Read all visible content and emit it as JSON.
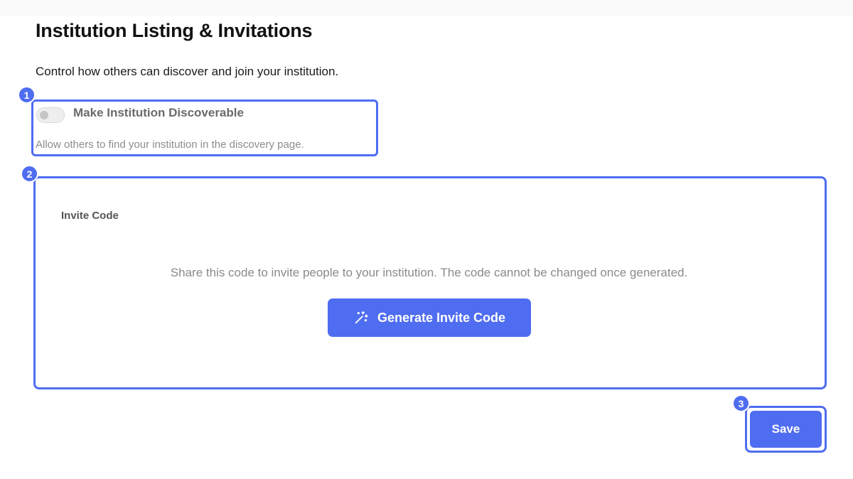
{
  "page": {
    "title": "Institution Listing & Invitations",
    "subtitle": "Control how others can discover and join your institution."
  },
  "discoverable": {
    "label": "Make Institution Discoverable",
    "help": "Allow others to find your institution in the discovery page.",
    "enabled": false
  },
  "invite": {
    "title": "Invite Code",
    "description": "Share this code to invite people to your institution. The code cannot be changed once generated.",
    "button_label": "Generate Invite Code",
    "button_icon": "magic-wand-icon"
  },
  "actions": {
    "save_label": "Save"
  },
  "annotations": [
    "1",
    "2",
    "3"
  ],
  "colors": {
    "accent": "#4f6df0",
    "muted_text": "#8a8a8a",
    "toggle_off": "#eeeeee"
  }
}
